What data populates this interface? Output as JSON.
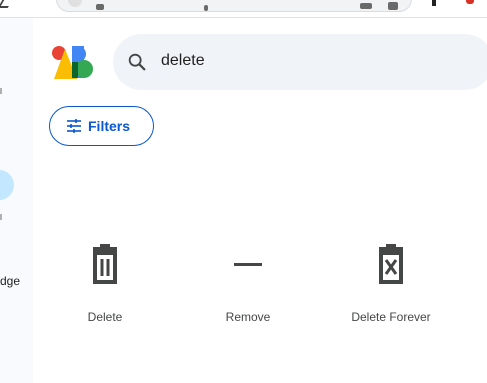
{
  "search": {
    "query": "delete"
  },
  "toolbar": {
    "filters_label": "Filters"
  },
  "sidebar": {
    "partial_label": "dge"
  },
  "results": [
    {
      "label": "Delete",
      "icon": "delete-icon"
    },
    {
      "label": "Remove",
      "icon": "remove-icon"
    },
    {
      "label": "Delete Forever",
      "icon": "delete-forever-icon"
    }
  ],
  "colors": {
    "accent": "#0b57d0",
    "icon": "#444746",
    "search_bg": "#f0f4f9",
    "rail_bg": "#f8fafd",
    "rail_selected": "#c2e7ff",
    "logo_red": "#ea4335",
    "logo_yellow": "#fbbc04",
    "logo_blue": "#4285f4",
    "logo_green": "#34a853"
  }
}
